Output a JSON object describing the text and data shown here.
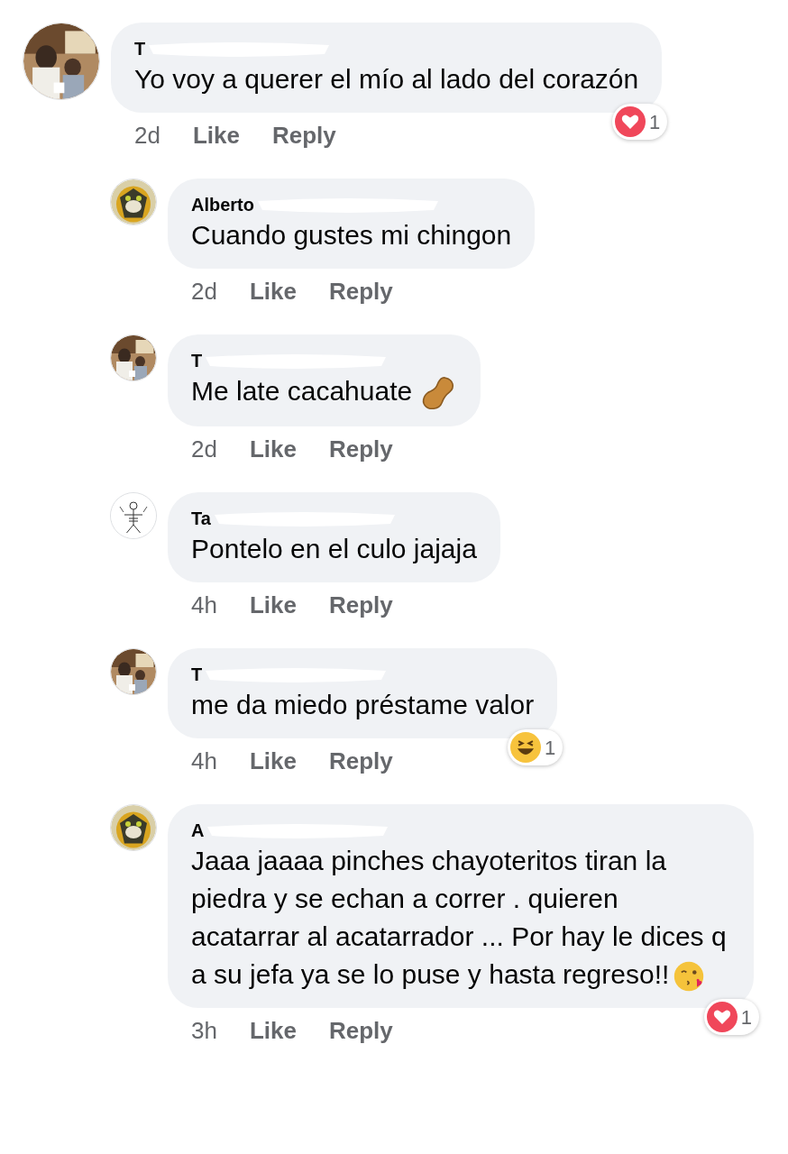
{
  "comments": [
    {
      "kind": "top",
      "name": "T",
      "text": "Yo voy a querer el mío al lado del corazón",
      "time": "2d",
      "like": "Like",
      "reply": "Reply",
      "reaction": {
        "kind": "heart",
        "count": "1"
      }
    },
    {
      "kind": "reply",
      "name": "Alberto",
      "text": "Cuando gustes mi chingon",
      "time": "2d",
      "like": "Like",
      "reply": "Reply"
    },
    {
      "kind": "reply",
      "name": "T",
      "text": "Me late cacahuate",
      "trailing_icon": {
        "kind": "peanut"
      },
      "time": "2d",
      "like": "Like",
      "reply": "Reply"
    },
    {
      "kind": "reply",
      "name": "Ta",
      "text": "Pontelo en el culo jajaja",
      "time": "4h",
      "like": "Like",
      "reply": "Reply"
    },
    {
      "kind": "reply",
      "name": "T",
      "text": "me da miedo préstame valor",
      "time": "4h",
      "like": "Like",
      "reply": "Reply",
      "reaction": {
        "kind": "laugh",
        "count": "1"
      }
    },
    {
      "kind": "reply",
      "name": "A",
      "text": "Jaaa jaaaa pinches chayoteritos tiran la piedra y se echan a correr . quieren acatarrar al acatarrador ... Por hay le dices q a su jefa ya se lo puse y hasta regreso!!",
      "trailing_icon": {
        "kind": "kiss"
      },
      "time": "3h",
      "like": "Like",
      "reply": "Reply",
      "reaction": {
        "kind": "heart",
        "count": "1"
      }
    }
  ]
}
